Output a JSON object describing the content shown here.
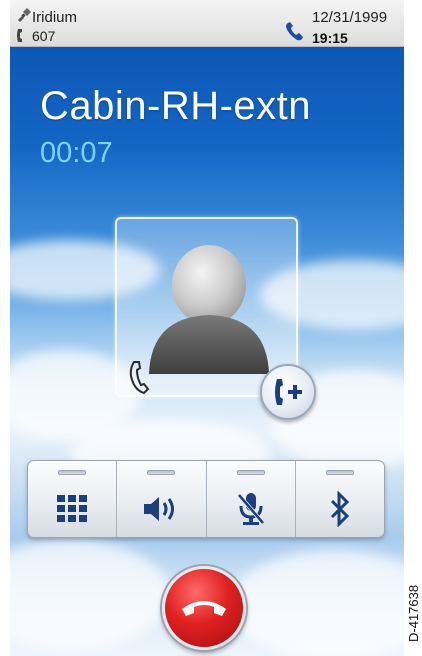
{
  "status_bar": {
    "network": "Iridium",
    "line": "607",
    "date": "12/31/1999",
    "time": "19:15",
    "icons": [
      "satellite-icon",
      "handset-icon",
      "active-call-icon"
    ]
  },
  "call": {
    "contact_name": "Cabin-RH-extn",
    "duration": "00:07"
  },
  "avatar": {
    "icon": "person-silhouette-icon"
  },
  "add_call": {
    "icon": "add-call-icon"
  },
  "controls": [
    {
      "name": "keypad",
      "icon": "keypad-icon",
      "active": false
    },
    {
      "name": "speaker",
      "icon": "speaker-icon",
      "active": false
    },
    {
      "name": "mute",
      "icon": "mute-mic-icon",
      "active": false
    },
    {
      "name": "bluetooth",
      "icon": "bluetooth-icon",
      "active": false
    }
  ],
  "end_call": {
    "icon": "end-call-icon",
    "color": "#e02020"
  },
  "colors": {
    "accent": "#7fd3f7",
    "sky": "#1466c4",
    "end_call": "#e02020"
  },
  "figure_id": "D-417638"
}
